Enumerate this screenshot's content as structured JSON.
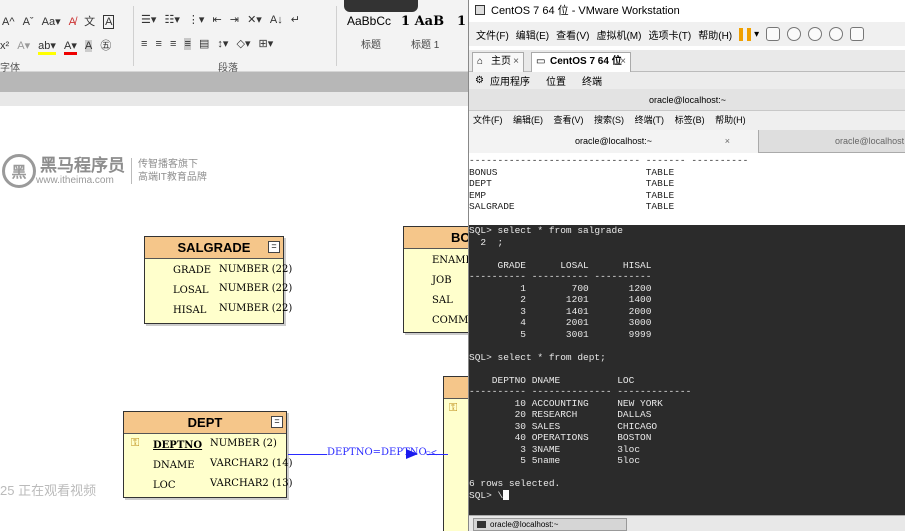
{
  "ribbon": {
    "font_row1": [
      "A",
      "A",
      "Aa",
      "A",
      "A"
    ],
    "font_row2": [
      "A",
      "A",
      "A"
    ],
    "group_font": "字体",
    "group_paragraph": "段落",
    "style_preview_1": "AaBbCc",
    "style_preview_2": "1 AaB",
    "style_preview_3": "1",
    "style_name_1": "标题",
    "style_name_2": "标题 1"
  },
  "logo": {
    "mark": "黑",
    "name": "黑马程序员",
    "url": "www.itheima.com",
    "slogan_1": "传智播客旗下",
    "slogan_2": "高端IT教育品牌"
  },
  "tables": {
    "salgrade": {
      "name": "SALGRADE",
      "rows": [
        {
          "col": "GRADE",
          "type": "NUMBER (22)"
        },
        {
          "col": "LOSAL",
          "type": "NUMBER (22)"
        },
        {
          "col": "HISAL",
          "type": "NUMBER (22)"
        }
      ]
    },
    "bonus": {
      "name": "BO",
      "rows": [
        "ENAME",
        "JOB",
        "SAL",
        "COMM"
      ]
    },
    "dept": {
      "name": "DEPT",
      "rows": [
        {
          "col": "DEPTNO",
          "type": "NUMBER (2)"
        },
        {
          "col": "DNAME",
          "type": "VARCHAR2 (14)"
        },
        {
          "col": "LOC",
          "type": "VARCHAR2 (13)"
        }
      ]
    }
  },
  "relation_label": "DEPTNO=DEPTNO",
  "watching_text": "25 正在观看视频",
  "vmware": {
    "title": "CentOS 7 64 位 - VMware Workstation",
    "menu": [
      "文件(F)",
      "编辑(E)",
      "查看(V)",
      "虚拟机(M)",
      "选项卡(T)",
      "帮助(H)"
    ],
    "tab_home": "主页",
    "tab_vm": "CentOS 7 64 位",
    "gnome_apps": "应用程序",
    "gnome_places": "位置",
    "gnome_terminal": "终端",
    "terminal_title": "oracle@localhost:~",
    "terminal_menu": [
      "文件(F)",
      "编辑(E)",
      "查看(V)",
      "搜索(S)",
      "终端(T)",
      "标签(B)",
      "帮助(H)"
    ],
    "terminal_tab_1": "oracle@localhost:~",
    "terminal_tab_2": "oracle@localhost",
    "status_tab": "oracle@localhost:~"
  },
  "terminal": {
    "top_output": "------------------------------ ------- ----------\nBONUS                          TABLE\nDEPT                           TABLE\nEMP                            TABLE\nSALGRADE                       TABLE",
    "main_output": "SQL> select * from salgrade\n  2  ;\n\n     GRADE      LOSAL      HISAL\n---------- ---------- ----------\n         1        700       1200\n         2       1201       1400\n         3       1401       2000\n         4       2001       3000\n         5       3001       9999\n\nSQL> select * from dept;\n\n    DEPTNO DNAME          LOC\n---------- -------------- -------------\n        10 ACCOUNTING     NEW YORK\n        20 RESEARCH       DALLAS\n        30 SALES          CHICAGO\n        40 OPERATIONS     BOSTON\n         3 3NAME          3loc\n         5 5name          5loc\n\n6 rows selected.\n",
    "prompt": "SQL> \\"
  }
}
